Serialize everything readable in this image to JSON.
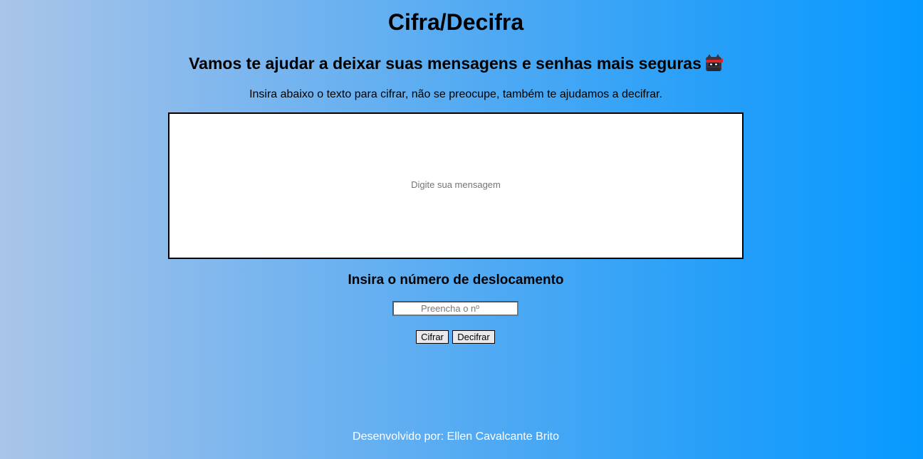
{
  "header": {
    "title": "Cifra/Decifra",
    "subtitle": "Vamos te ajudar a deixar suas mensagens e senhas mais seguras",
    "subtitle_icon": "ninja-icon",
    "instructions": "Insira abaixo o texto para cifrar, não se preocupe, também te ajudamos a decifrar."
  },
  "message": {
    "placeholder": "Digite sua mensagem",
    "value": ""
  },
  "shift": {
    "label": "Insira o número de deslocamento",
    "placeholder": "Preencha o nº",
    "value": ""
  },
  "actions": {
    "encrypt_label": "Cifrar",
    "decrypt_label": "Decifrar"
  },
  "footer": {
    "credit": "Desenvolvido por: Ellen Cavalcante Brito"
  }
}
